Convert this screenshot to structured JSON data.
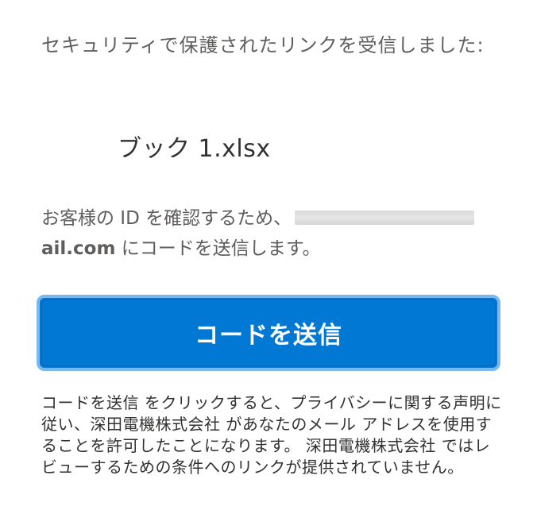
{
  "intro": {
    "text": "セキュリティで保護されたリンクを受信しました:"
  },
  "file": {
    "name": "ブック 1.xlsx"
  },
  "verify": {
    "text_before": "お客様の ID を確認するため、",
    "email_domain": "ail.com",
    "text_after": " にコードを送信します。"
  },
  "send_button": {
    "label": "コードを送信"
  },
  "disclaimer": {
    "text": "コードを送信 をクリックすると、プライバシーに関する声明に従い、深田電機株式会社 があなたのメール アドレスを使用することを許可したことになります。 深田電機株式会社 ではレビューするための条件へのリンクが提供されていません。"
  },
  "colors": {
    "primary": "#0078d4",
    "button_border": "#7bb8f2",
    "text_secondary": "#605e5c",
    "text_primary": "#323130"
  }
}
